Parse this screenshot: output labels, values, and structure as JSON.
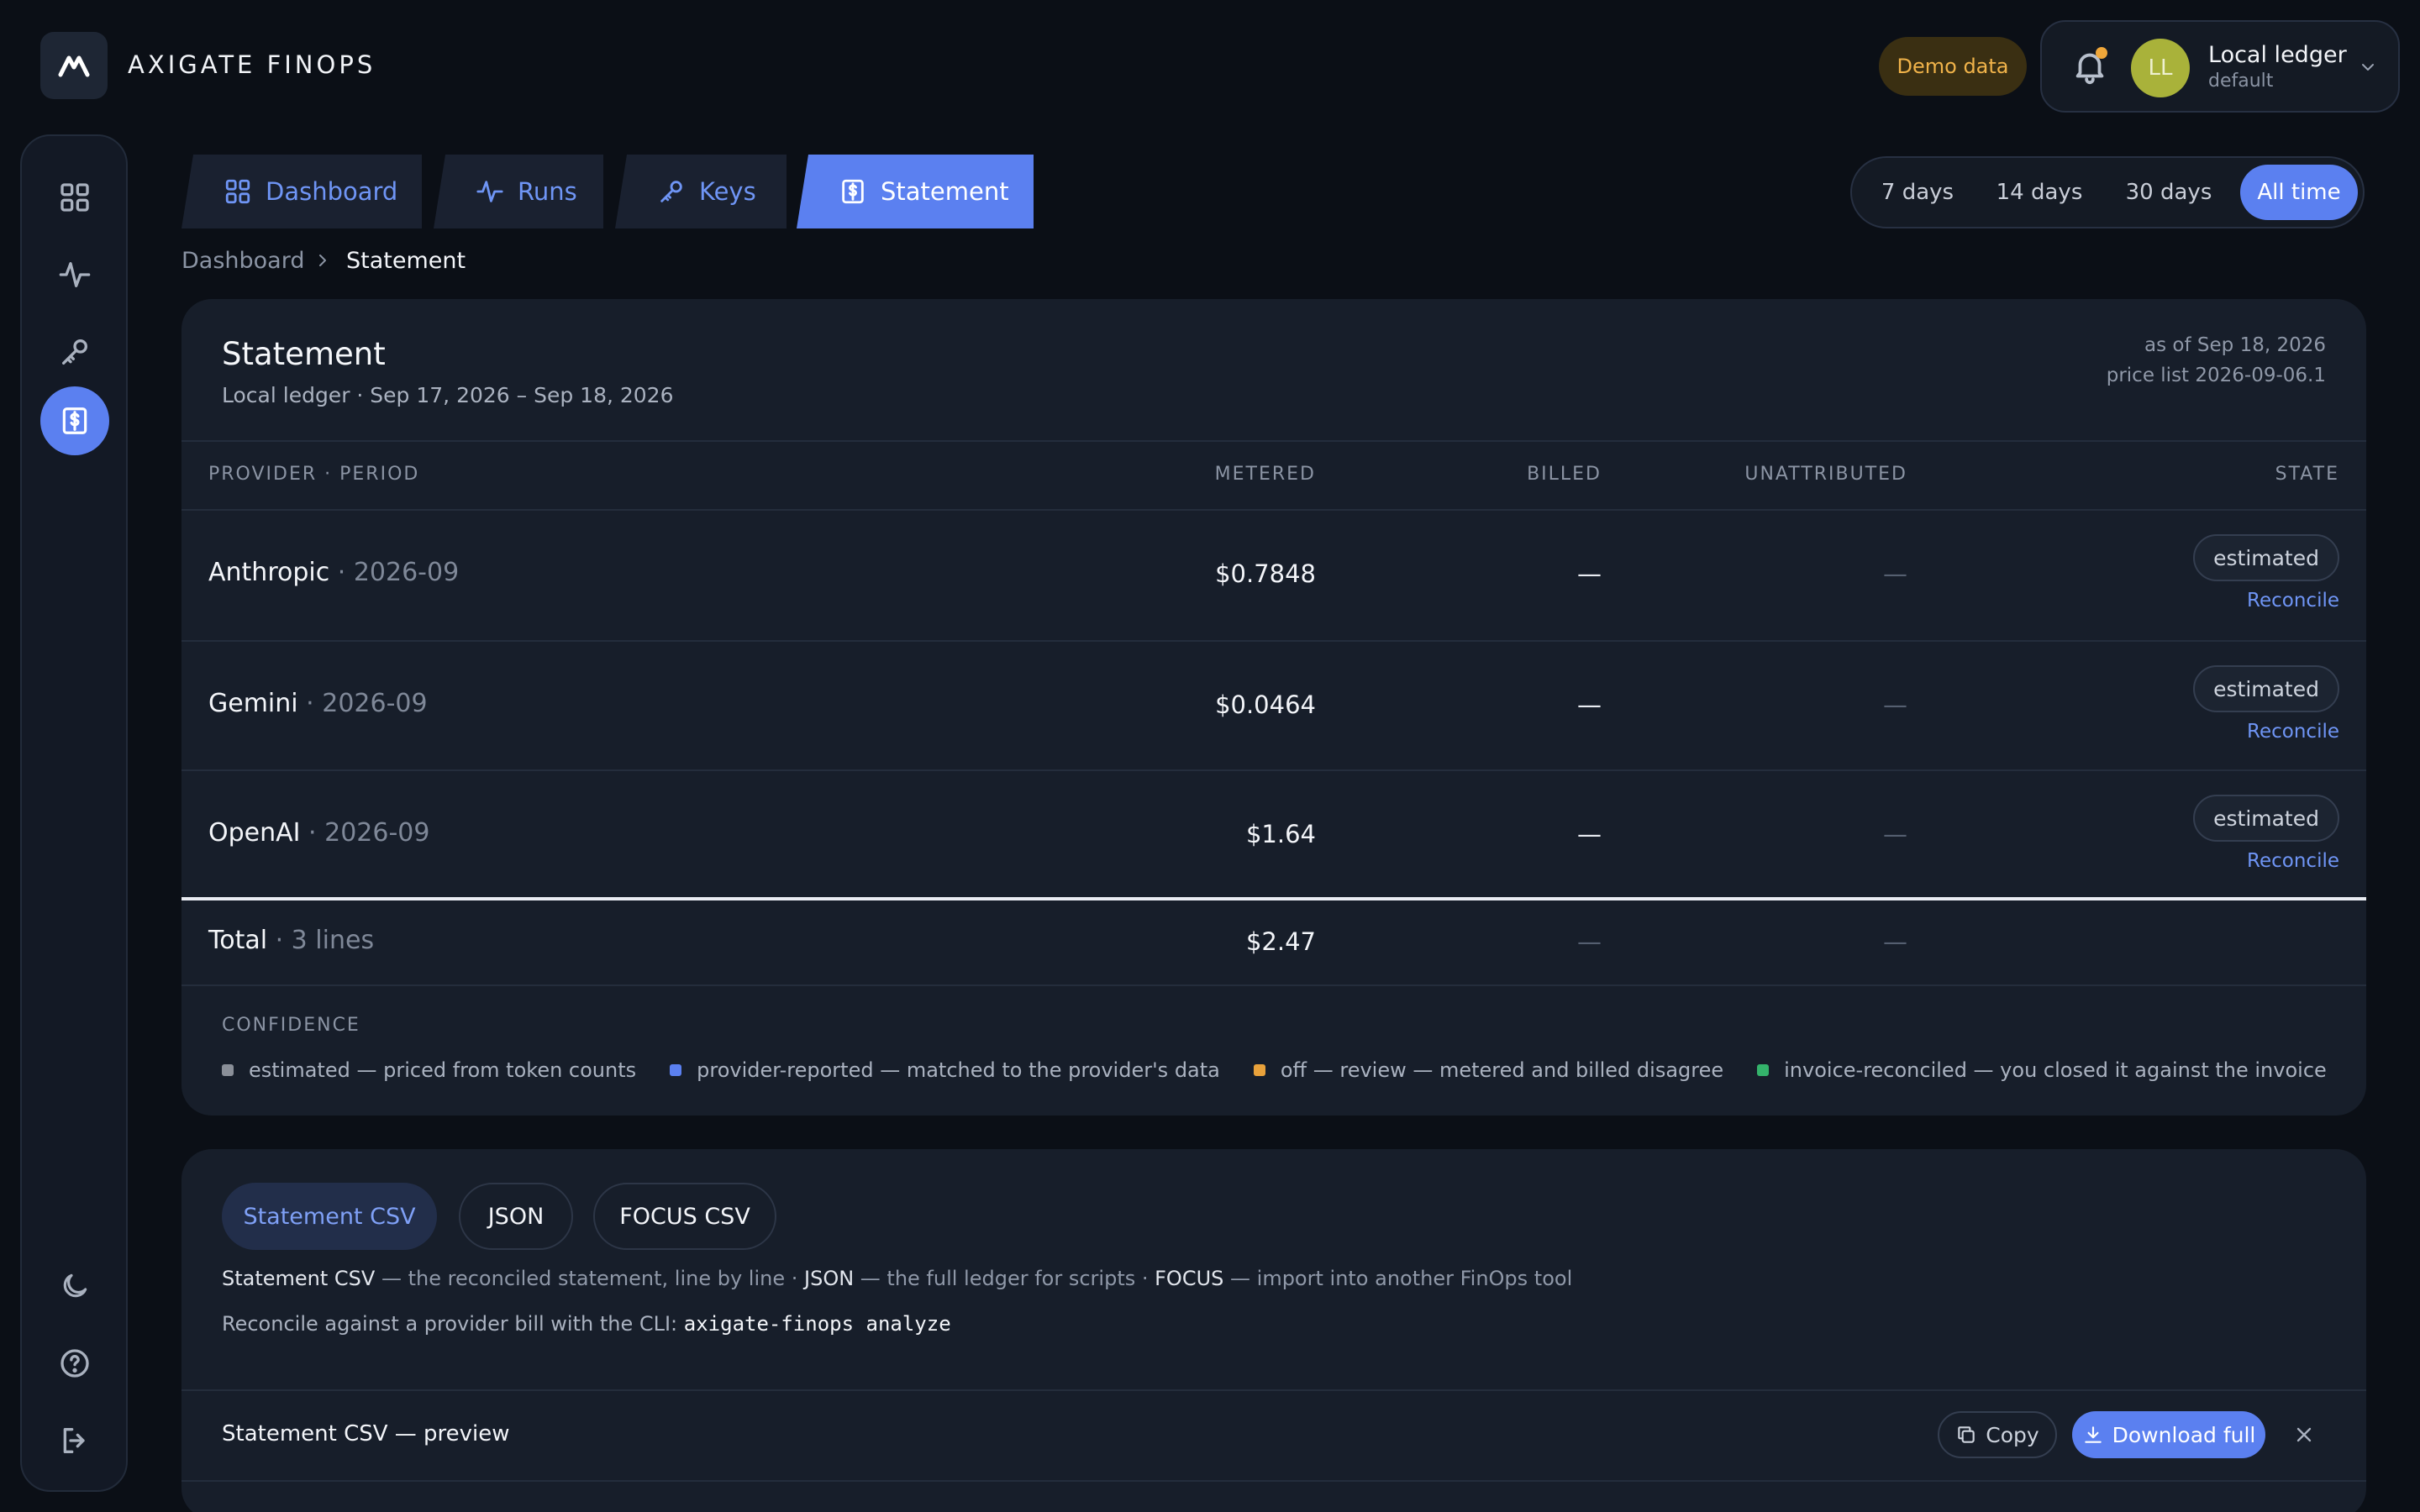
{
  "brand": {
    "name": "AXIGATE FINOPS"
  },
  "header": {
    "demo_badge": "Demo data",
    "user": {
      "initials": "LL",
      "name": "Local ledger",
      "workspace": "default"
    }
  },
  "tabs": [
    {
      "label": "Dashboard",
      "icon": "grid-icon"
    },
    {
      "label": "Runs",
      "icon": "activity-icon"
    },
    {
      "label": "Keys",
      "icon": "key-icon"
    },
    {
      "label": "Statement",
      "icon": "receipt-icon",
      "active": true
    }
  ],
  "ranges": [
    {
      "label": "7 days"
    },
    {
      "label": "14 days"
    },
    {
      "label": "30 days"
    },
    {
      "label": "All time",
      "active": true
    }
  ],
  "breadcrumb": {
    "home": "Dashboard",
    "current": "Statement"
  },
  "statement": {
    "title": "Statement",
    "subtitle": "Local ledger · Sep 17, 2026 – Sep 18, 2026",
    "as_of": "as of Sep 18, 2026",
    "price_list": "price list 2026-09-06.1",
    "columns": {
      "provider": "PROVIDER · PERIOD",
      "metered": "METERED",
      "billed": "BILLED",
      "unattributed": "UNATTRIBUTED",
      "state": "STATE"
    },
    "rows": [
      {
        "provider": "Anthropic",
        "period": " · 2026-09",
        "metered": "$0.7848",
        "billed": "—",
        "unattributed": "—",
        "state": "estimated",
        "action": "Reconcile"
      },
      {
        "provider": "Gemini",
        "period": " · 2026-09",
        "metered": "$0.0464",
        "billed": "—",
        "unattributed": "—",
        "state": "estimated",
        "action": "Reconcile"
      },
      {
        "provider": "OpenAI",
        "period": " · 2026-09",
        "metered": "$1.64",
        "billed": "—",
        "unattributed": "—",
        "state": "estimated",
        "action": "Reconcile"
      }
    ],
    "total": {
      "label": "Total",
      "lines": " · 3 lines",
      "metered": "$2.47",
      "billed": "—",
      "unattributed": "—"
    },
    "confidence": {
      "title": "CONFIDENCE",
      "items": [
        {
          "label": "estimated — priced from token counts",
          "color": "#8a8f98"
        },
        {
          "label": "provider-reported — matched to the provider's data",
          "color": "#5b80f0"
        },
        {
          "label": "off — review — metered and billed disagree",
          "color": "#e9a23b"
        },
        {
          "label": "invoice-reconciled — you closed it against the invoice",
          "color": "#34b36b"
        }
      ]
    }
  },
  "export": {
    "buttons": [
      {
        "label": "Statement CSV",
        "active": true
      },
      {
        "label": "JSON"
      },
      {
        "label": "FOCUS CSV"
      }
    ],
    "desc": {
      "csv_name": "Statement CSV",
      "csv_text": " — the reconciled statement, line by line · ",
      "json_name": "JSON",
      "json_text": " — the full ledger for scripts · ",
      "focus_name": "FOCUS",
      "focus_text": " — import into another FinOps tool"
    },
    "cli_text": "Reconcile against a provider bill with the CLI: ",
    "cli_cmd": "axigate-finops analyze",
    "preview_title": "Statement CSV — preview",
    "copy_label": "Copy",
    "download_label": "Download full"
  }
}
